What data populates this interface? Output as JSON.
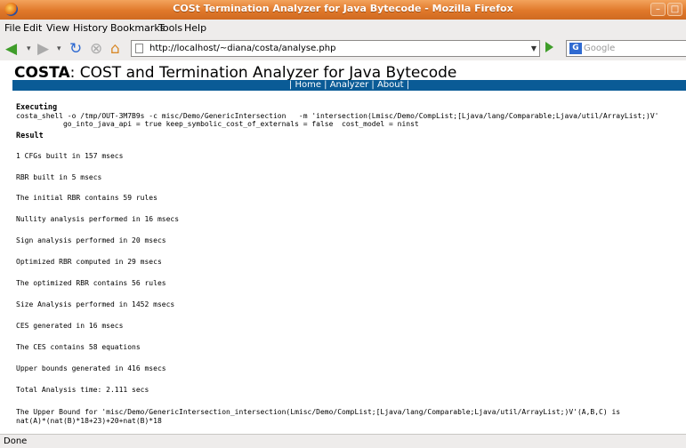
{
  "window": {
    "title": "COSt Termination Analyzer for Java Bytecode - Mozilla Firefox"
  },
  "menubar": {
    "items": [
      "File",
      "Edit",
      "View",
      "History",
      "Bookmarks",
      "Tools",
      "Help"
    ]
  },
  "navbar": {
    "url": "http://localhost/~diana/costa/analyse.php",
    "search_placeholder": "Google"
  },
  "page": {
    "brand": "COSTA",
    "heading_rest": ": COST and Termination Analyzer for Java Bytecode",
    "nav_links": [
      "Home",
      "Analyzer",
      "About"
    ],
    "executing_label": "Executing",
    "command_line1": "costa_shell -o /tmp/OUT-3M7B9s -c misc/Demo/GenericIntersection   -m 'intersection(Lmisc/Demo/CompList;[Ljava/lang/Comparable;Ljava/util/ArrayList;)V'",
    "command_line2": "           go_into_java_api = true keep_symbolic_cost_of_externals = false  cost_model = ninst",
    "result_label": "Result",
    "results": [
      "1 CFGs built in 157 msecs",
      "RBR built in 5 msecs",
      "The initial RBR contains 59 rules",
      "Nullity analysis performed in 16 msecs",
      "Sign analysis performed in 20 msecs",
      "Optimized RBR computed in 29 msecs",
      "The optimized RBR contains 56 rules",
      "Size Analysis performed in 1452 msecs",
      "CES generated in 16 msecs",
      "The CES contains 58 equations",
      "Upper bounds generated in 416 msecs",
      "Total Analysis time: 2.111 secs"
    ],
    "upper_bound_line1": "The Upper Bound for 'misc/Demo/GenericIntersection_intersection(Lmisc/Demo/CompList;[Ljava/lang/Comparable;Ljava/util/ArrayList;)V'(A,B,C) is",
    "upper_bound_line2": "nat(A)*(nat(B)*18+23)+20+nat(B)*18"
  },
  "status": {
    "text": "Done"
  }
}
